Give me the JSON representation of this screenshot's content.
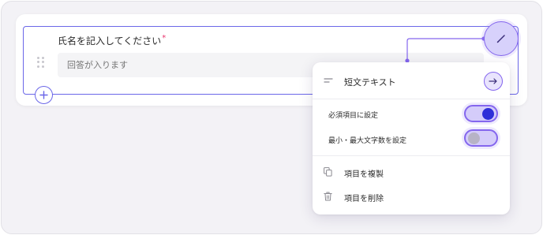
{
  "question": {
    "label": "氏名を記入してください",
    "required_mark": "*",
    "answer_placeholder": "回答が入ります"
  },
  "panel": {
    "type": {
      "label": "短文テキスト",
      "icon": "short-text-icon"
    },
    "settings": [
      {
        "label": "必須項目に設定",
        "enabled": true
      },
      {
        "label": "最小・最大文字数を設定",
        "enabled": false
      }
    ],
    "actions": [
      {
        "label": "項目を複製",
        "icon": "duplicate-icon"
      },
      {
        "label": "項目を削除",
        "icon": "trash-icon"
      }
    ]
  },
  "colors": {
    "accent": "#6b67e8",
    "accent_purple": "#8466ee",
    "toggle_on_knob": "#2e2fd8",
    "required": "#e8356d"
  }
}
